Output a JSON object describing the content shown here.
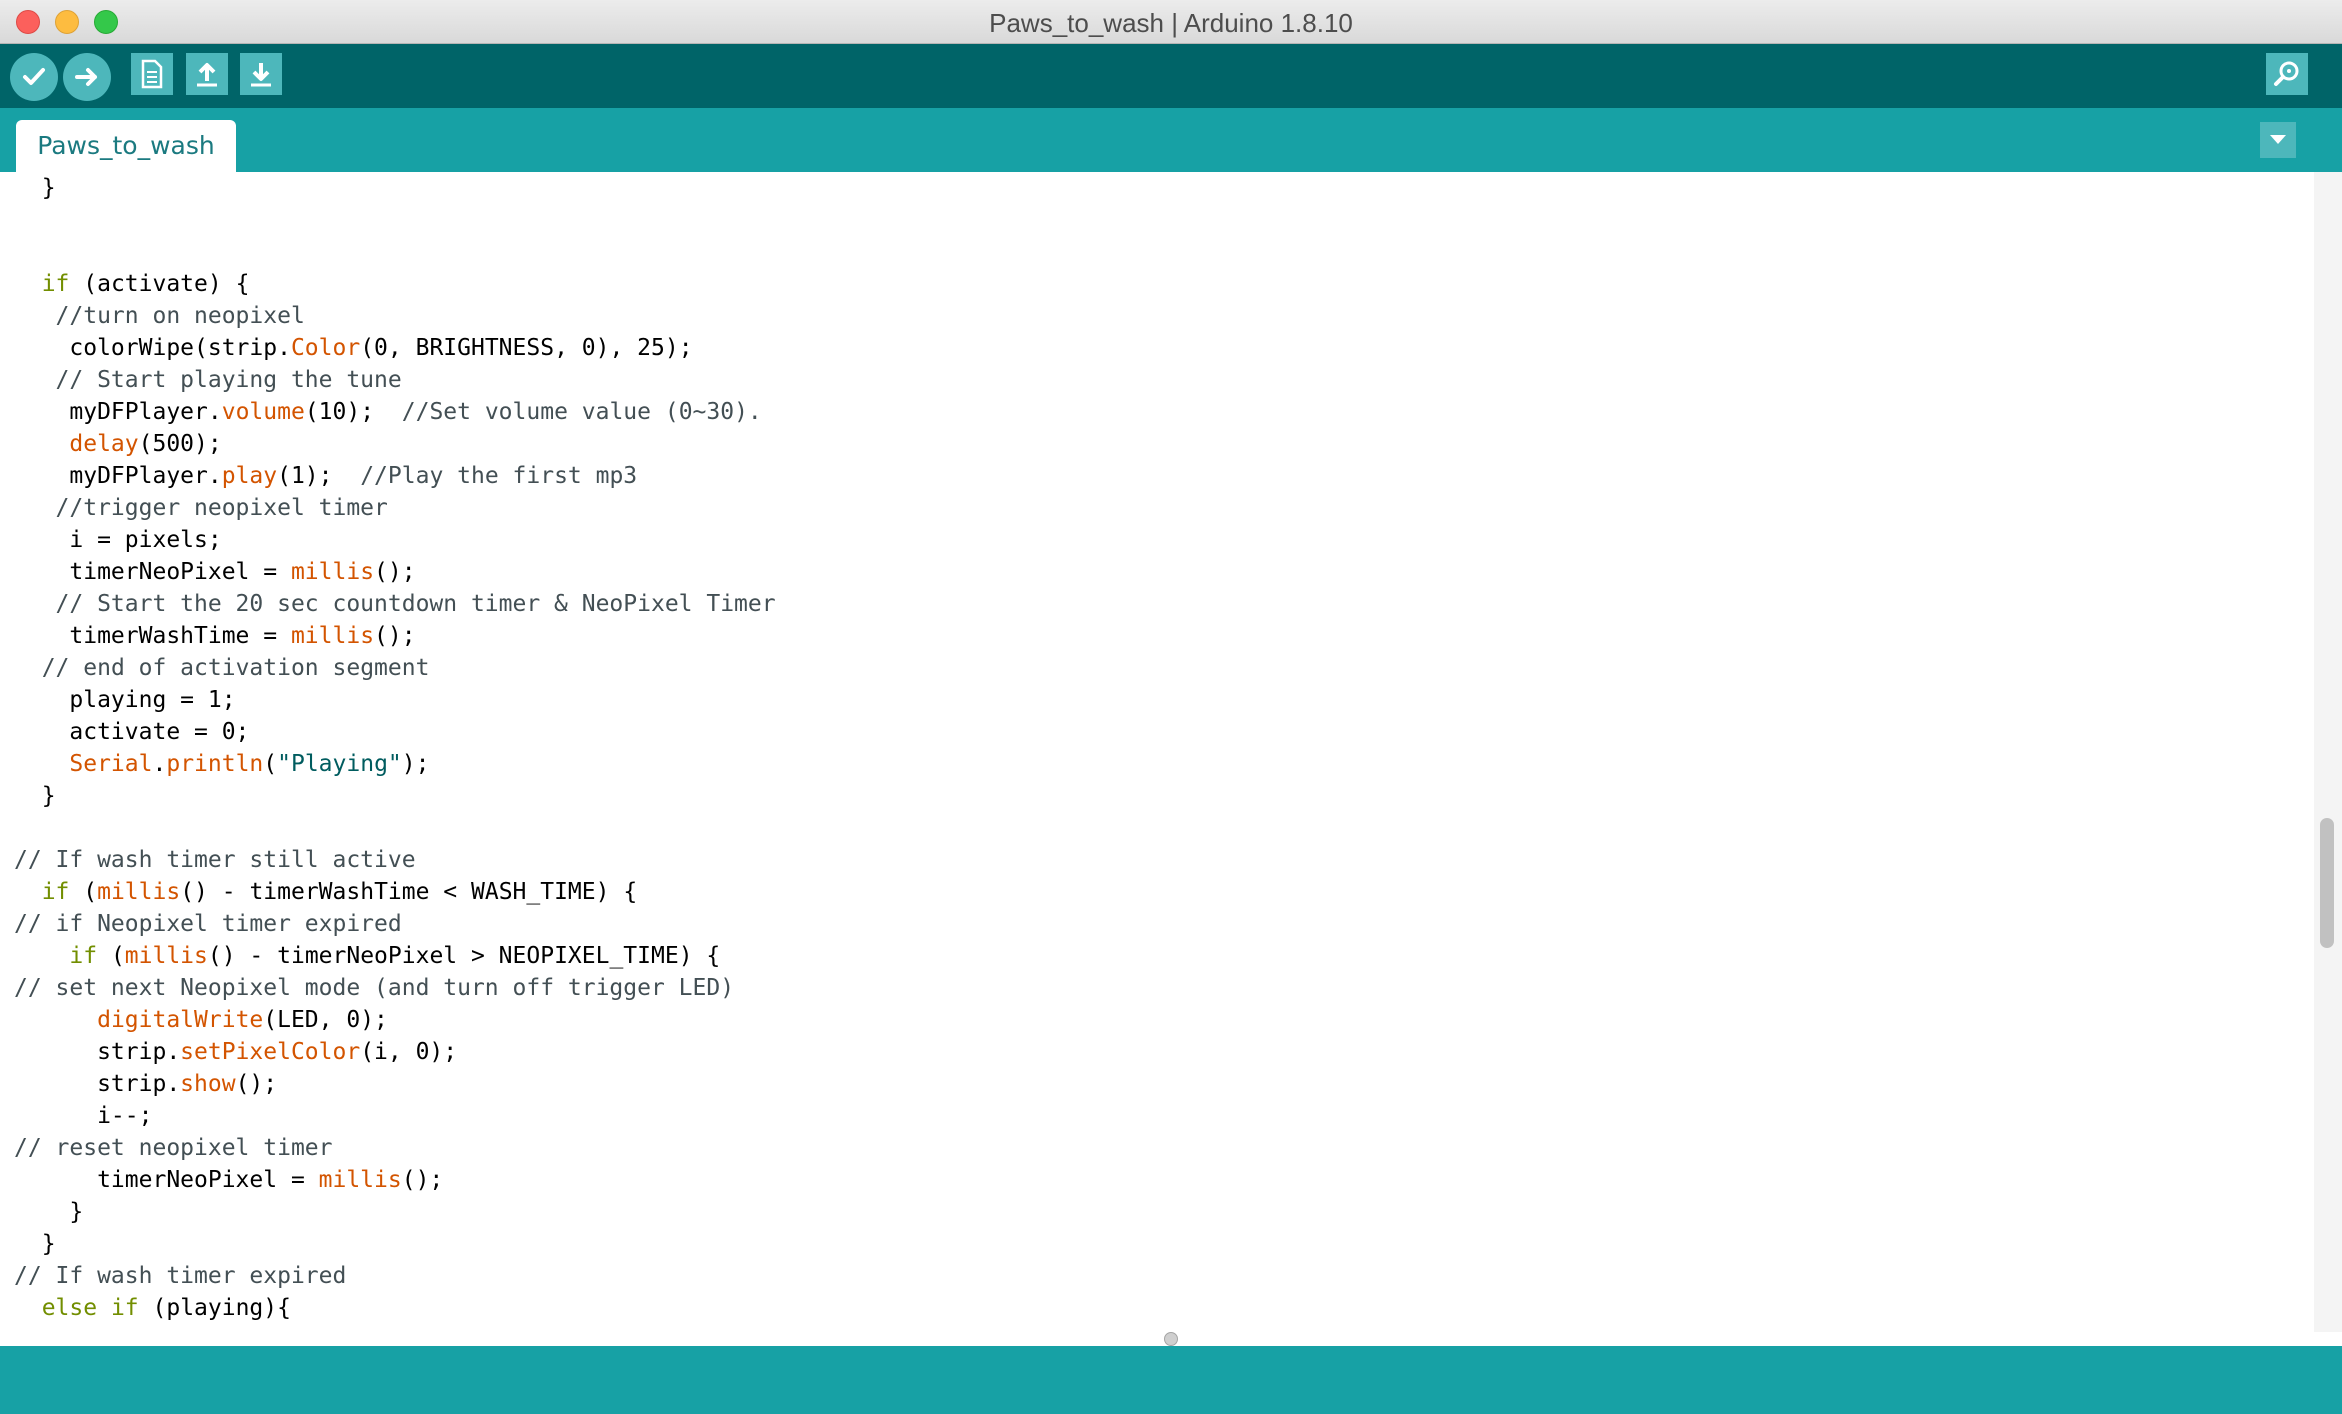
{
  "window": {
    "title": "Paws_to_wash | Arduino 1.8.10"
  },
  "toolbar": {
    "buttons": [
      {
        "name": "verify",
        "icon": "check-icon"
      },
      {
        "name": "upload",
        "icon": "arrow-right-icon"
      },
      {
        "name": "new",
        "icon": "document-icon"
      },
      {
        "name": "open",
        "icon": "arrow-up-icon"
      },
      {
        "name": "save",
        "icon": "arrow-down-icon"
      },
      {
        "name": "serial-monitor",
        "icon": "magnifier-icon"
      }
    ]
  },
  "tabs": [
    {
      "label": "Paws_to_wash",
      "active": true
    }
  ],
  "editor": {
    "lines": [
      "  }",
      "",
      "",
      "  if (activate) {",
      "   //turn on neopixel",
      "    colorWipe(strip.Color(0, BRIGHTNESS, 0), 25);",
      "   // Start playing the tune",
      "    myDFPlayer.volume(10);  //Set volume value (0~30).",
      "    delay(500);",
      "    myDFPlayer.play(1);  //Play the first mp3",
      "   //trigger neopixel timer",
      "    i = pixels;",
      "    timerNeoPixel = millis();",
      "   // Start the 20 sec countdown timer & NeoPixel Timer",
      "    timerWashTime = millis();",
      "  // end of activation segment",
      "    playing = 1;",
      "    activate = 0;",
      "    Serial.println(\"Playing\");",
      "  }",
      "",
      "// If wash timer still active",
      "  if (millis() - timerWashTime < WASH_TIME) {",
      "// if Neopixel timer expired",
      "    if (millis() - timerNeoPixel > NEOPIXEL_TIME) {",
      "// set next Neopixel mode (and turn off trigger LED)",
      "      digitalWrite(LED, 0);",
      "      strip.setPixelColor(i, 0);",
      "      strip.show();",
      "      i--;",
      "// reset neopixel timer",
      "      timerNeoPixel = millis();",
      "    }",
      "  }",
      "// If wash timer expired",
      "  else if (playing){"
    ],
    "keywords": [
      "if",
      "else"
    ],
    "functions": [
      "Color",
      "volume",
      "delay",
      "play",
      "millis",
      "Serial",
      "println",
      "digitalWrite",
      "setPixelColor",
      "show"
    ]
  },
  "colors": {
    "toolbar": "#006468",
    "tabstrip": "#17a1a5",
    "button": "#4db7bb",
    "keyword": "#728e00",
    "function": "#d35400",
    "comment": "#434f54",
    "string": "#005c5f"
  }
}
